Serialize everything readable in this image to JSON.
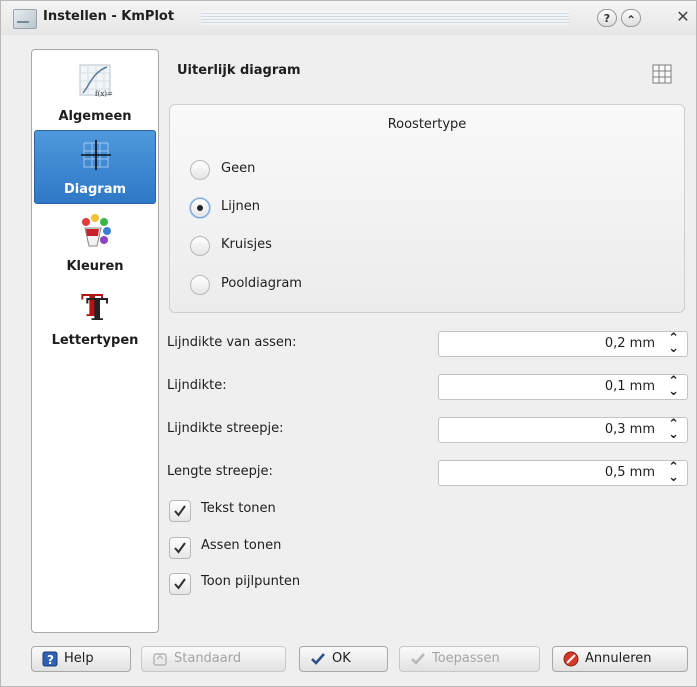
{
  "window": {
    "title": "Instellen - KmPlot",
    "help_glyph": "?",
    "shade_glyph": "⌃",
    "close_glyph": "✕"
  },
  "sidebar": {
    "items": [
      {
        "label": "Algemeen",
        "icon": "function-graph-icon",
        "active": false
      },
      {
        "label": "Diagram",
        "icon": "axes-grid-icon",
        "active": true
      },
      {
        "label": "Kleuren",
        "icon": "color-palette-icon",
        "active": false
      },
      {
        "label": "Lettertypen",
        "icon": "font-icon",
        "active": false
      }
    ]
  },
  "page": {
    "title": "Uiterlijk diagram",
    "header_icon": "grid-icon"
  },
  "grid_type": {
    "title": "Roostertype",
    "options": [
      {
        "label": "Geen",
        "checked": false
      },
      {
        "label": "Lijnen",
        "checked": true
      },
      {
        "label": "Kruisjes",
        "checked": false
      },
      {
        "label": "Pooldiagram",
        "checked": false
      }
    ]
  },
  "fields": [
    {
      "label": "Lijndikte van assen:",
      "value": "0,2 mm"
    },
    {
      "label": "Lijndikte:",
      "value": "0,1 mm"
    },
    {
      "label": "Lijndikte streepje:",
      "value": "0,3 mm"
    },
    {
      "label": "Lengte streepje:",
      "value": "0,5 mm"
    }
  ],
  "checks": [
    {
      "label": "Tekst tonen",
      "checked": true
    },
    {
      "label": "Assen tonen",
      "checked": true
    },
    {
      "label": "Toon pijlpunten",
      "checked": true
    }
  ],
  "buttons": {
    "help": "Help",
    "defaults": "Standaard",
    "ok": "OK",
    "apply": "Toepassen",
    "cancel": "Annuleren"
  },
  "colors": {
    "selection": "#3a86d2",
    "window_bg": "#efefef",
    "cancel_icon": "#d23a2a",
    "check_icon": "#2d4f8a"
  }
}
